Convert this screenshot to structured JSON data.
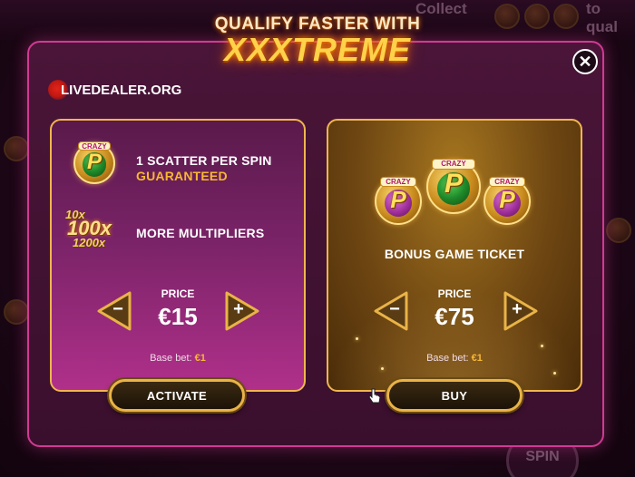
{
  "background": {
    "collect_text": "Collect",
    "to_qual_text": "to qual",
    "spin_label": "SPIN"
  },
  "header": {
    "line1": "QUALIFY FASTER WITH",
    "line2": "XXXTREME"
  },
  "watermark": {
    "text": "LIVEDEALER.ORG"
  },
  "close": {
    "icon": "close-icon",
    "glyph": "✕"
  },
  "left_panel": {
    "feature1": {
      "coin_tag": "CRAZY",
      "coin_letter": "P",
      "line1": "1 SCATTER PER SPIN",
      "line2": "GUARANTEED"
    },
    "feature2": {
      "mult_small_top": "10x",
      "mult_big": "100x",
      "mult_small_bottom": "1200x",
      "text": "MORE MULTIPLIERS"
    },
    "price_label": "PRICE",
    "price_value": "€15",
    "minus": "−",
    "plus": "+",
    "base_bet_label": "Base bet:",
    "base_bet_value": "€1",
    "button_label": "ACTIVATE"
  },
  "right_panel": {
    "coin_tag": "CRAZY",
    "coin_letter": "P",
    "title": "BONUS GAME TICKET",
    "price_label": "PRICE",
    "price_value": "€75",
    "minus": "−",
    "plus": "+",
    "base_bet_label": "Base bet:",
    "base_bet_value": "€1",
    "button_label": "BUY"
  },
  "colors": {
    "accent_gold": "#f7b733",
    "modal_border": "#d13a93",
    "panel_border": "#f0b64e"
  }
}
